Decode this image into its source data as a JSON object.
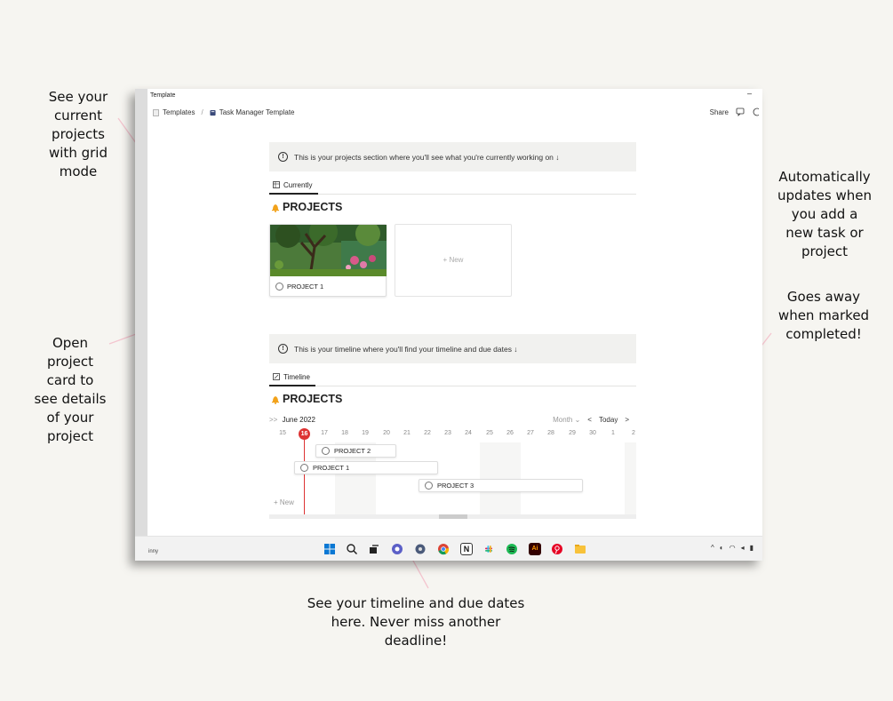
{
  "annotations": {
    "grid_mode": [
      "See your",
      "current",
      "projects",
      "with grid",
      "mode"
    ],
    "open_card": [
      "Open",
      "project",
      "card to",
      "see details",
      "of your",
      "project"
    ],
    "auto_updates": [
      "Automatically",
      "updates when",
      "you add a",
      "new task or",
      "project"
    ],
    "goes_away": [
      "Goes away",
      "when marked",
      "completed!"
    ],
    "timeline": [
      "See your timeline and due dates",
      "here. Never miss another",
      "deadline!"
    ]
  },
  "window": {
    "title": "Template",
    "minimize": "–",
    "breadcrumb": {
      "root": "Templates",
      "separator": "/",
      "page": "Task Manager Template"
    },
    "share_label": "Share"
  },
  "projects_section": {
    "notice": "This is your projects section where you'll see what you're currently working on ↓",
    "info_glyph": "!",
    "tab_label": "Currently",
    "heading": "PROJECTS",
    "card_title": "PROJECT 1",
    "new_label": "+ New"
  },
  "timeline_section": {
    "notice": "This is your timeline where you'll find your timeline and due dates ↓",
    "info_glyph": "!",
    "tab_label": "Timeline",
    "heading": "PROJECTS",
    "month_label": "June 2022",
    "expand_glyph": ">>",
    "view_label": "Month",
    "today_label": "Today",
    "prev": "<",
    "next": ">",
    "days": [
      "15",
      "16",
      "17",
      "18",
      "19",
      "20",
      "21",
      "22",
      "23",
      "24",
      "25",
      "26",
      "27",
      "28",
      "29",
      "30",
      "1",
      "2"
    ],
    "today_day": "16",
    "bars": [
      {
        "name": "PROJECT 2"
      },
      {
        "name": "PROJECT 1"
      },
      {
        "name": "PROJECT 3"
      }
    ],
    "new_label": "+ New"
  },
  "taskbar": {
    "user_label": "inny",
    "icons": [
      "windows-icon",
      "search-icon",
      "task-view-icon",
      "chat-icon",
      "settings-icon",
      "chrome-icon",
      "notion-icon",
      "slack-icon",
      "spotify-icon",
      "illustrator-icon",
      "pinterest-icon",
      "folder-icon"
    ],
    "notion_glyph": "N",
    "illustrator_glyph": "Ai",
    "tray_chevron": "^"
  },
  "colors": {
    "today_red": "#d33333",
    "background": "#f6f5f1"
  }
}
